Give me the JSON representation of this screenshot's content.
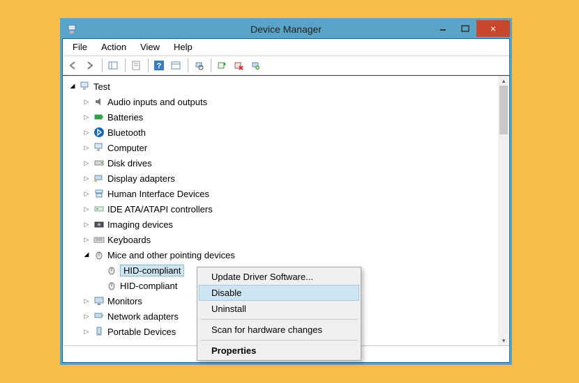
{
  "window": {
    "title": "Device Manager"
  },
  "menu": {
    "file": "File",
    "action": "Action",
    "view": "View",
    "help": "Help"
  },
  "tree": {
    "root": "Test",
    "nodes": {
      "audio": "Audio inputs and outputs",
      "batteries": "Batteries",
      "bluetooth": "Bluetooth",
      "computer": "Computer",
      "disks": "Disk drives",
      "display": "Display adapters",
      "hid": "Human Interface Devices",
      "ide": "IDE ATA/ATAPI controllers",
      "imaging": "Imaging devices",
      "keyboards": "Keyboards",
      "mice": "Mice and other pointing devices",
      "mice_child_selected": "HID-compliant",
      "mice_child_other": "HID-compliant",
      "monitors": "Monitors",
      "network": "Network adapters",
      "portable": "Portable Devices"
    }
  },
  "context_menu": {
    "update": "Update Driver Software...",
    "disable": "Disable",
    "uninstall": "Uninstall",
    "scan": "Scan for hardware changes",
    "properties": "Properties"
  }
}
